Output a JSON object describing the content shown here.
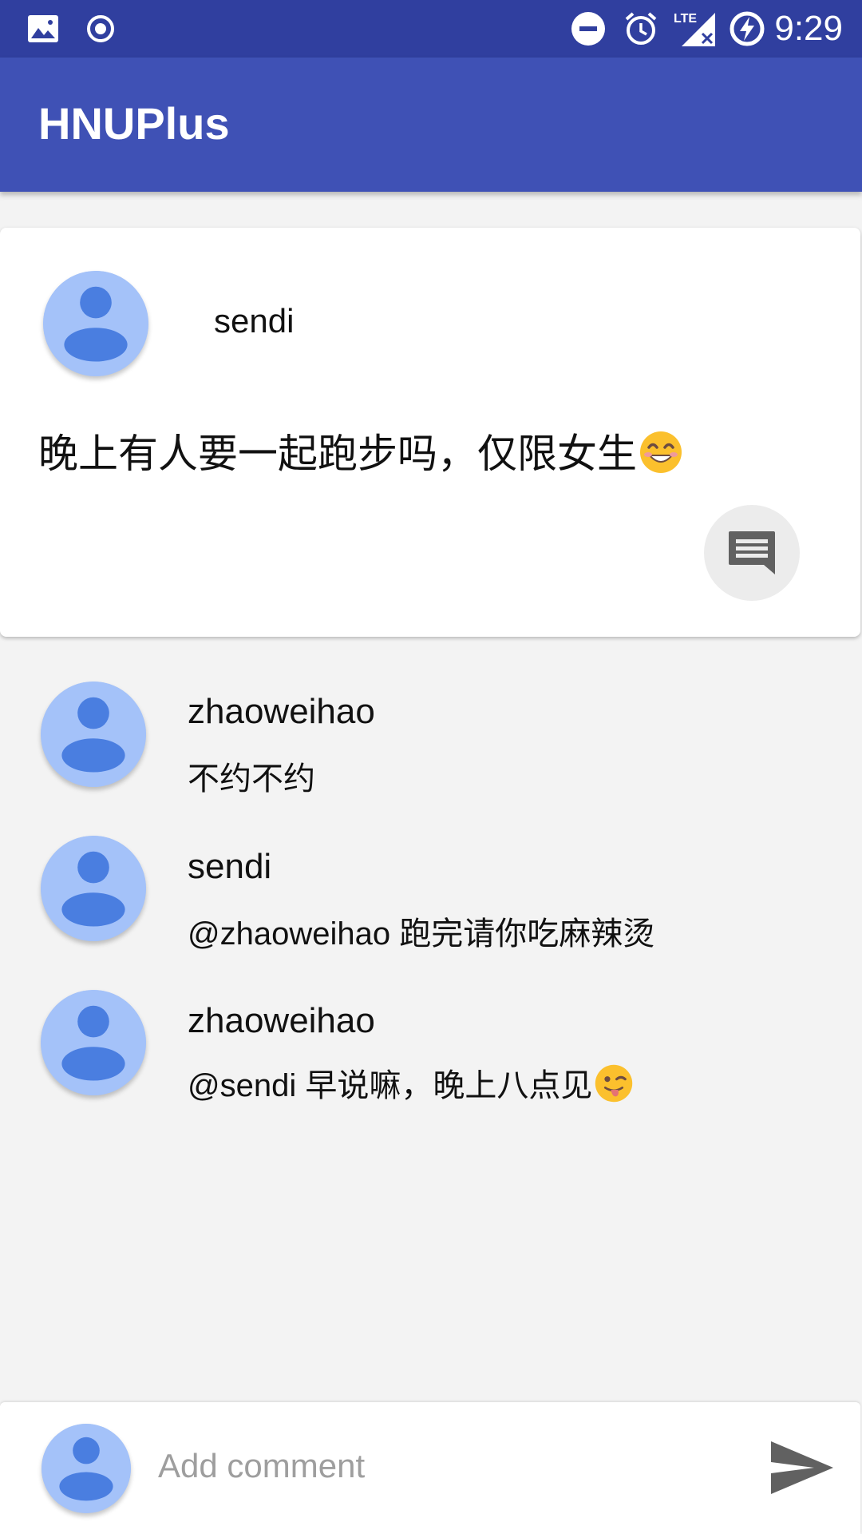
{
  "status_bar": {
    "time": "9:29",
    "icons": [
      "image-icon",
      "record-icon",
      "do-not-disturb-icon",
      "alarm-icon",
      "lte-signal-icon",
      "battery-charging-icon"
    ]
  },
  "app_bar": {
    "title": "HNUPlus"
  },
  "post": {
    "author": "sendi",
    "text": "晚上有人要一起跑步吗，仅限女生",
    "emoji": "smiling-face-emoji",
    "comment_icon": "comment-icon"
  },
  "comments": [
    {
      "author": "zhaoweihao",
      "text": "不约不约"
    },
    {
      "author": "sendi",
      "text": "@zhaoweihao 跑完请你吃麻辣烫"
    },
    {
      "author": "zhaoweihao",
      "text": "@sendi 早说嘛，晚上八点见",
      "emoji": "winking-tongue-emoji"
    }
  ],
  "input_bar": {
    "placeholder": "Add comment",
    "value": "",
    "send_icon": "send-icon"
  },
  "colors": {
    "status_bar": "#303f9f",
    "app_bar": "#3f51b5",
    "avatar_bg": "#a4c2f9",
    "avatar_fg": "#4a7ee0",
    "background": "#f3f3f3"
  }
}
